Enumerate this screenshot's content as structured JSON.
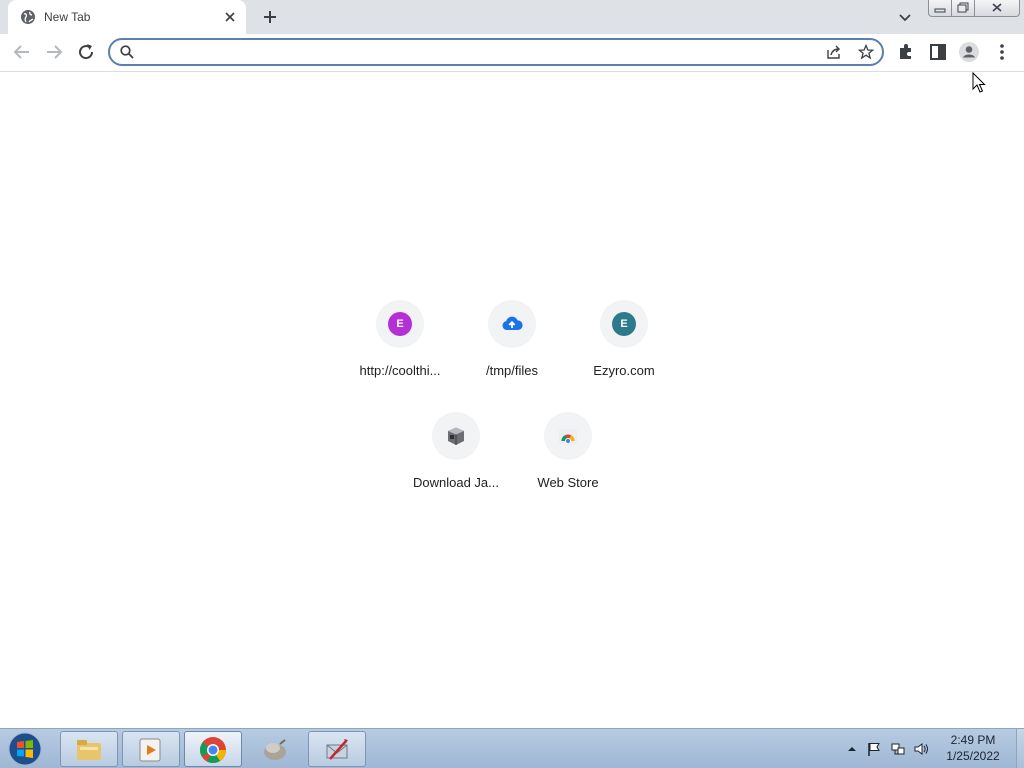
{
  "browser": {
    "tab_title": "New Tab",
    "address_value": "",
    "address_placeholder": ""
  },
  "shortcuts": [
    {
      "label": "http://coolthi...",
      "icon": "letter-e-purple",
      "letter": "E",
      "color": "#b52fd6"
    },
    {
      "label": "/tmp/files",
      "icon": "cloud-upload-icon",
      "color": "#1a73e8"
    },
    {
      "label": "Ezyro.com",
      "icon": "letter-e-teal",
      "letter": "E",
      "color": "#2d7a8c"
    },
    {
      "label": "Download Ja...",
      "icon": "box-icon"
    },
    {
      "label": "Web Store",
      "icon": "chrome-web-store-icon"
    }
  ],
  "taskbar": {
    "apps": [
      "windows-explorer",
      "media-player",
      "chrome",
      "network-tool",
      "mail-tool"
    ],
    "active_app": "chrome",
    "time": "2:49 PM",
    "date": "1/25/2022"
  },
  "colors": {
    "tabstrip": "#dee1e6",
    "omnibox_focus_border": "#5b7fb0",
    "taskbar": "#a9c0da"
  }
}
